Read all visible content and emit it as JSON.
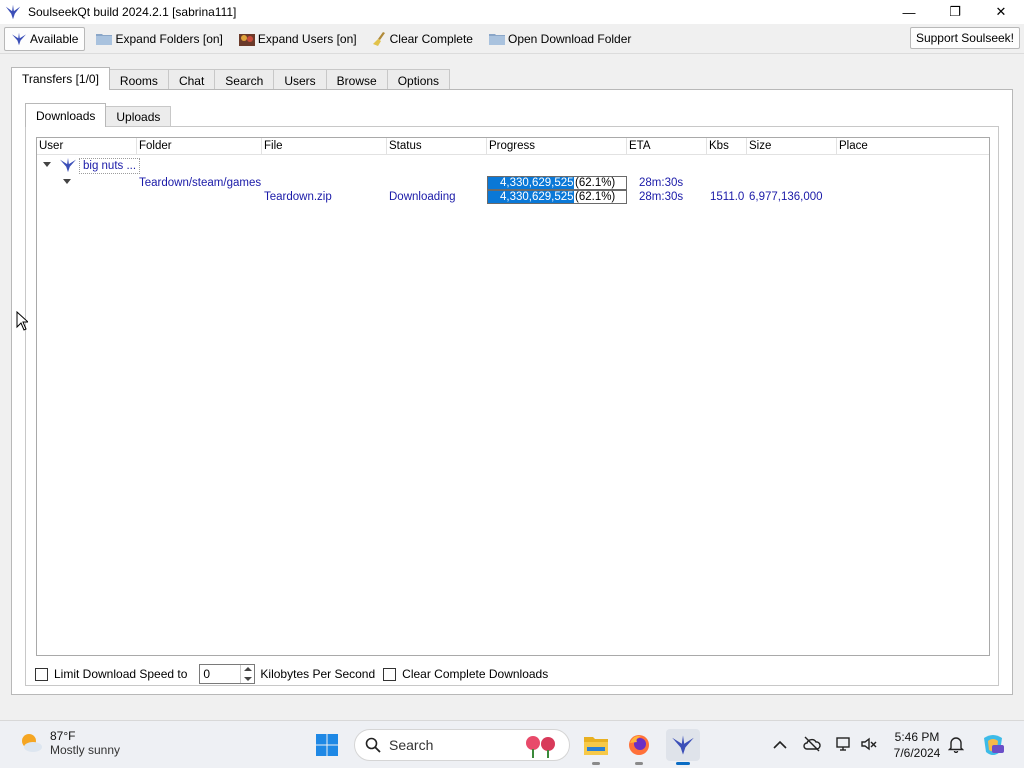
{
  "window": {
    "title": "SoulseekQt build 2024.2.1 [sabrina111]",
    "minimize": "—",
    "maximize": "❐",
    "close": "✕"
  },
  "toolbar": {
    "available": "Available",
    "expand_folders": "Expand Folders [on]",
    "expand_users": "Expand Users [on]",
    "clear_complete": "Clear Complete",
    "open_download_folder": "Open Download Folder",
    "support": "Support Soulseek!"
  },
  "main_tabs": [
    "Transfers [1/0]",
    "Rooms",
    "Chat",
    "Search",
    "Users",
    "Browse",
    "Options"
  ],
  "sub_tabs": [
    "Downloads",
    "Uploads"
  ],
  "columns": [
    "User",
    "Folder",
    "File",
    "Status",
    "Progress",
    "ETA",
    "Kbs",
    "Size",
    "Place"
  ],
  "transfers": {
    "user": "big nuts ...",
    "folder": "Teardown/steam/games",
    "folder_progress_bytes": "4,330,629,525",
    "folder_progress_pct": "(62.1%)",
    "folder_progress_fraction": 0.621,
    "folder_eta": "28m:30s",
    "file": "Teardown.zip",
    "status": "Downloading",
    "file_progress_bytes": "4,330,629,525",
    "file_progress_pct": "(62.1%)",
    "file_progress_fraction": 0.621,
    "file_eta": "28m:30s",
    "kbs": "1511.0",
    "size": "6,977,136,000"
  },
  "bottom": {
    "limit_label": "Limit Download Speed to",
    "speed_value": "0",
    "unit_label": "Kilobytes Per Second",
    "clear_complete_label": "Clear Complete Downloads"
  },
  "taskbar": {
    "temperature": "87°F",
    "condition": "Mostly sunny",
    "search_placeholder": "Search",
    "time": "5:46 PM",
    "date": "7/6/2024"
  },
  "colors": {
    "accent": "#0a78d7",
    "link_text": "#1a1aa8"
  }
}
